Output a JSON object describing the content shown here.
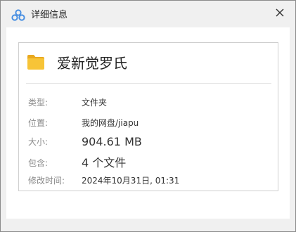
{
  "window": {
    "title": "详细信息",
    "icons": {
      "app": "baidu-netdisk-icon",
      "close": "close-icon",
      "folder": "folder-icon"
    }
  },
  "item": {
    "name": "爱新觉罗氏"
  },
  "details": {
    "type_label": "类型:",
    "type_value": "文件夹",
    "location_label": "位置:",
    "location_value": "我的网盘/jiapu",
    "size_label": "大小:",
    "size_value": "904.61 MB",
    "contains_label": "包含:",
    "contains_value": "4 个文件",
    "modified_label": "修改时间:",
    "modified_value": "2024年10月31日, 01:31"
  },
  "colors": {
    "folder_yellow": "#F7C437",
    "folder_tab": "#E9A91F",
    "app_icon_blue": "#4A90E2"
  }
}
